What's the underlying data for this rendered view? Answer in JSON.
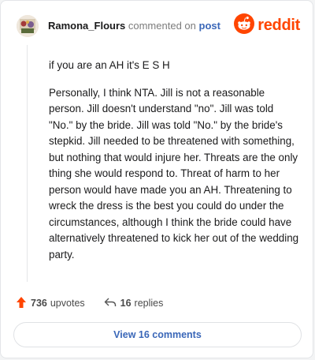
{
  "header": {
    "username": "Ramona_Flours",
    "action_text": "commented on",
    "post_link_label": "post",
    "brand_wordmark": "reddit"
  },
  "comment": {
    "paragraphs": [
      "if you are an AH it's E S H",
      "Personally, I think NTA. Jill is not a reasonable person. Jill doesn't understand \"no\". Jill was told \"No.\" by the bride. Jill was told \"No.\" by the bride's stepkid. Jill needed to be threatened with something, but nothing that would injure her. Threats are the only thing she would respond to. Threat of harm to her person would have made you an AH. Threatening to wreck the dress is the best you could do under the circumstances, although I think the bride could have alternatively threatened to kick her out of the wedding party."
    ]
  },
  "footer": {
    "upvote_icon": "upvote-arrow-icon",
    "upvotes_count": "736",
    "upvotes_label": "upvotes",
    "reply_icon": "reply-arrow-icon",
    "replies_count": "16",
    "replies_label": "replies"
  },
  "view_comments_button": "View 16 comments",
  "colors": {
    "brand": "#ff4500",
    "link": "#3a67b8",
    "upvote": "#ff4500"
  }
}
